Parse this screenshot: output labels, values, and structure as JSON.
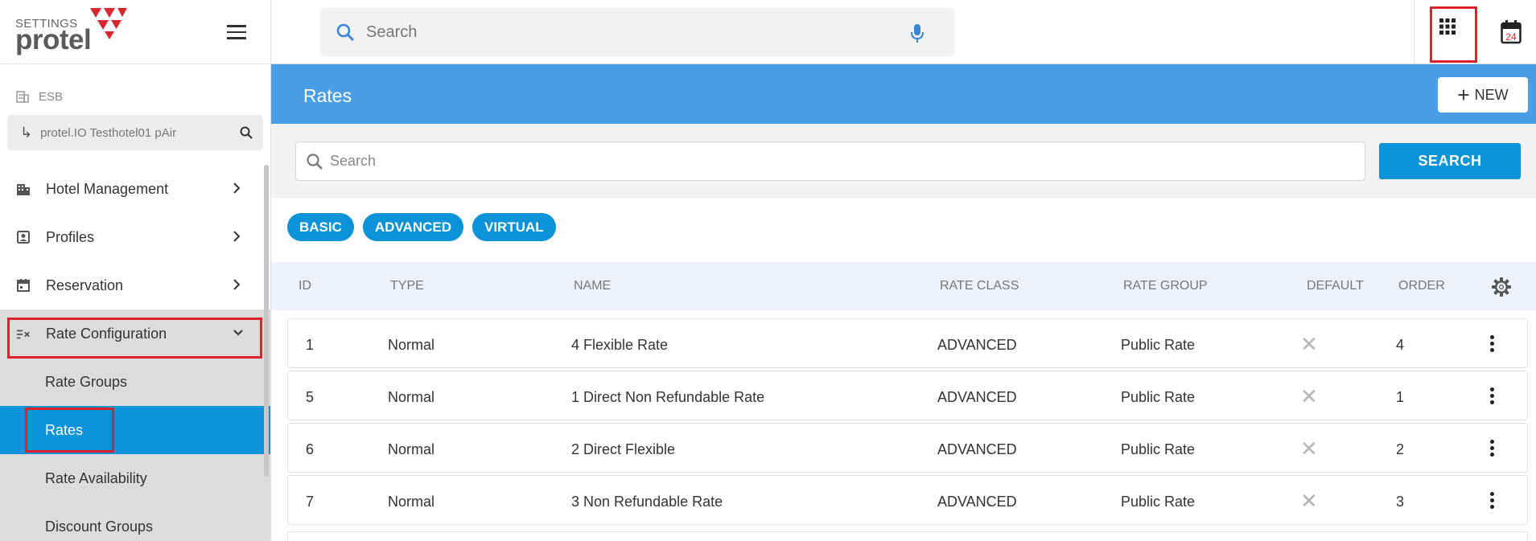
{
  "brand": {
    "settings_label": "SETTINGS",
    "name": "protel",
    "accent_color": "#d9252f"
  },
  "sidebar": {
    "org_label": "ESB",
    "hotel_label": "protel.IO Testhotel01 pAir",
    "nav": [
      {
        "label": "Hotel Management",
        "icon": "building-icon"
      },
      {
        "label": "Profiles",
        "icon": "profile-badge-icon"
      },
      {
        "label": "Reservation",
        "icon": "calendar-icon"
      },
      {
        "label": "Rate Configuration",
        "icon": "rate-config-icon",
        "expanded": true
      }
    ],
    "rate_subitems": [
      {
        "label": "Rate Groups"
      },
      {
        "label": "Rates",
        "active": true
      },
      {
        "label": "Rate Availability"
      },
      {
        "label": "Discount Groups"
      }
    ]
  },
  "topbar": {
    "search_placeholder": "Search",
    "calendar_day": "24"
  },
  "page": {
    "title": "Rates",
    "new_button": "NEW",
    "filter_placeholder": "Search",
    "search_button": "SEARCH",
    "chips": [
      "BASIC",
      "ADVANCED",
      "VIRTUAL"
    ]
  },
  "table": {
    "headers": {
      "id": "ID",
      "type": "TYPE",
      "name": "NAME",
      "rate_class": "RATE CLASS",
      "rate_group": "RATE GROUP",
      "default": "DEFAULT",
      "order": "ORDER"
    },
    "rows": [
      {
        "id": "1",
        "type": "Normal",
        "name": "4 Flexible Rate",
        "rate_class": "ADVANCED",
        "rate_group": "Public Rate",
        "default": false,
        "order": "4"
      },
      {
        "id": "5",
        "type": "Normal",
        "name": "1 Direct Non Refundable Rate",
        "rate_class": "ADVANCED",
        "rate_group": "Public Rate",
        "default": false,
        "order": "1"
      },
      {
        "id": "6",
        "type": "Normal",
        "name": "2 Direct Flexible",
        "rate_class": "ADVANCED",
        "rate_group": "Public Rate",
        "default": false,
        "order": "2"
      },
      {
        "id": "7",
        "type": "Normal",
        "name": "3 Non Refundable Rate",
        "rate_class": "ADVANCED",
        "rate_group": "Public Rate",
        "default": false,
        "order": "3"
      }
    ]
  },
  "colors": {
    "primary": "#0a93d8",
    "header_blue": "#4a9ee6",
    "highlight_red": "#e0202a"
  }
}
